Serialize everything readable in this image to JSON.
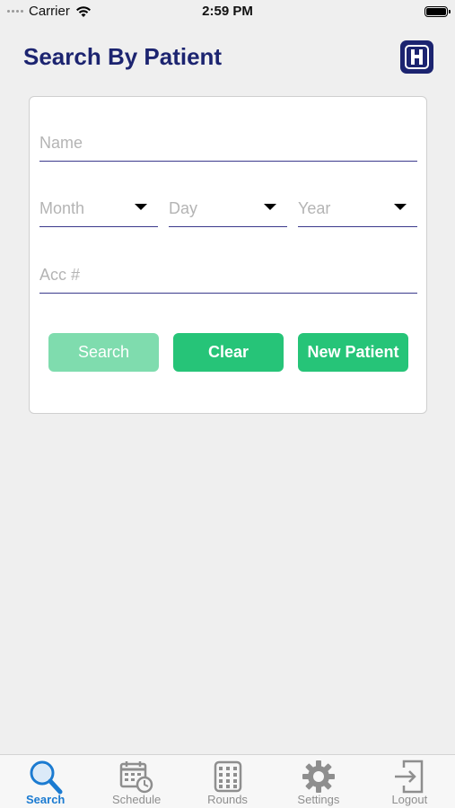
{
  "status_bar": {
    "carrier": "Carrier",
    "time": "2:59 PM"
  },
  "header": {
    "title": "Search By Patient"
  },
  "form": {
    "name_placeholder": "Name",
    "month_placeholder": "Month",
    "day_placeholder": "Day",
    "year_placeholder": "Year",
    "acc_placeholder": "Acc #"
  },
  "buttons": {
    "search": "Search",
    "clear": "Clear",
    "new_patient": "New Patient"
  },
  "tabs": [
    {
      "label": "Search",
      "icon": "search-icon",
      "active": true
    },
    {
      "label": "Schedule",
      "icon": "calendar-clock-icon",
      "active": false
    },
    {
      "label": "Rounds",
      "icon": "rounds-grid-icon",
      "active": false
    },
    {
      "label": "Settings",
      "icon": "gear-icon",
      "active": false
    },
    {
      "label": "Logout",
      "icon": "logout-icon",
      "active": false
    }
  ],
  "colors": {
    "brand_navy": "#1c2470",
    "accent_green": "#26c478",
    "disabled_green": "#7fdcae",
    "active_tab": "#1b7bd1"
  }
}
